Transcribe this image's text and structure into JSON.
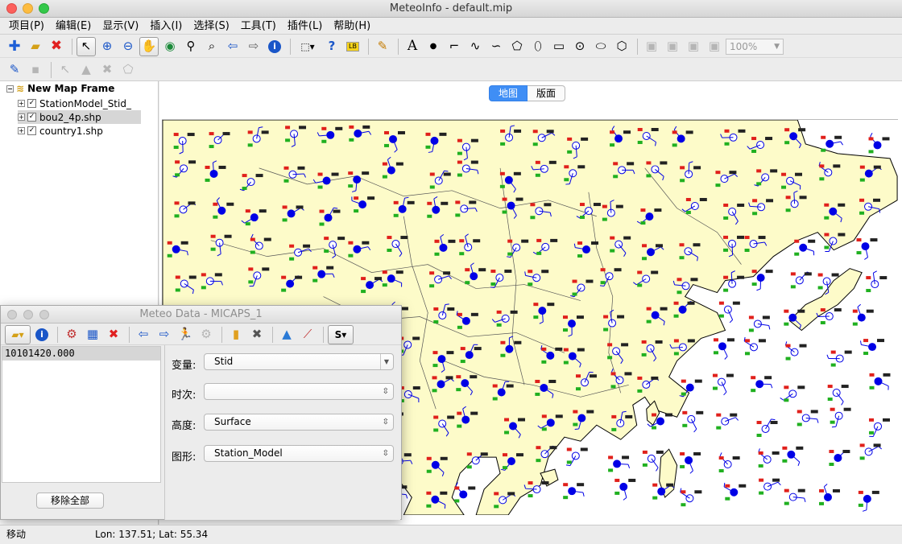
{
  "window": {
    "title": "MeteoInfo - default.mip"
  },
  "menubar": {
    "items": [
      "项目(P)",
      "编辑(E)",
      "显示(V)",
      "插入(I)",
      "选择(S)",
      "工具(T)",
      "插件(L)",
      "帮助(H)"
    ]
  },
  "toolbar": {
    "zoom_value": "100%"
  },
  "layers": {
    "root": "New Map Frame",
    "items": [
      {
        "name": "StationModel_Stid_",
        "checked": true,
        "selected": false
      },
      {
        "name": "bou2_4p.shp",
        "checked": true,
        "selected": true
      },
      {
        "name": "country1.shp",
        "checked": true,
        "selected": false
      }
    ]
  },
  "map": {
    "tabs": [
      "地图",
      "版面"
    ],
    "colors": {
      "land": "#fdfbc9",
      "sea": "#ffffff",
      "station": "#0000e6",
      "temp": "#e0201b",
      "dewpoint": "#20b020"
    }
  },
  "dialog": {
    "title": "Meteo Data - MICAPS_1",
    "file_item": "10101420.000",
    "remove_all_label": "移除全部",
    "props": {
      "variable": {
        "label": "变量:",
        "value": "Stid"
      },
      "time": {
        "label": "时次:",
        "value": ""
      },
      "level": {
        "label": "高度:",
        "value": "Surface"
      },
      "graphic": {
        "label": "图形:",
        "value": "Station_Model"
      }
    }
  },
  "status": {
    "mode": "移动",
    "coord": "Lon: 137.51; Lat: 55.34"
  }
}
